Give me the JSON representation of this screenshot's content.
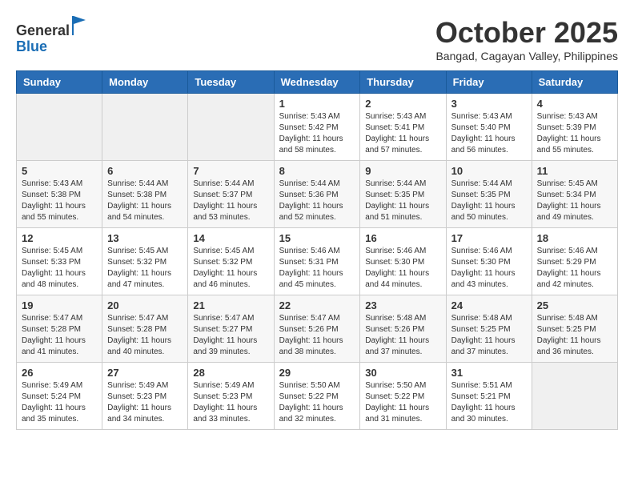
{
  "header": {
    "logo_line1": "General",
    "logo_line2": "Blue",
    "month": "October 2025",
    "location": "Bangad, Cagayan Valley, Philippines"
  },
  "weekdays": [
    "Sunday",
    "Monday",
    "Tuesday",
    "Wednesday",
    "Thursday",
    "Friday",
    "Saturday"
  ],
  "weeks": [
    [
      {
        "day": "",
        "info": ""
      },
      {
        "day": "",
        "info": ""
      },
      {
        "day": "",
        "info": ""
      },
      {
        "day": "1",
        "info": "Sunrise: 5:43 AM\nSunset: 5:42 PM\nDaylight: 11 hours\nand 58 minutes."
      },
      {
        "day": "2",
        "info": "Sunrise: 5:43 AM\nSunset: 5:41 PM\nDaylight: 11 hours\nand 57 minutes."
      },
      {
        "day": "3",
        "info": "Sunrise: 5:43 AM\nSunset: 5:40 PM\nDaylight: 11 hours\nand 56 minutes."
      },
      {
        "day": "4",
        "info": "Sunrise: 5:43 AM\nSunset: 5:39 PM\nDaylight: 11 hours\nand 55 minutes."
      }
    ],
    [
      {
        "day": "5",
        "info": "Sunrise: 5:43 AM\nSunset: 5:38 PM\nDaylight: 11 hours\nand 55 minutes."
      },
      {
        "day": "6",
        "info": "Sunrise: 5:44 AM\nSunset: 5:38 PM\nDaylight: 11 hours\nand 54 minutes."
      },
      {
        "day": "7",
        "info": "Sunrise: 5:44 AM\nSunset: 5:37 PM\nDaylight: 11 hours\nand 53 minutes."
      },
      {
        "day": "8",
        "info": "Sunrise: 5:44 AM\nSunset: 5:36 PM\nDaylight: 11 hours\nand 52 minutes."
      },
      {
        "day": "9",
        "info": "Sunrise: 5:44 AM\nSunset: 5:35 PM\nDaylight: 11 hours\nand 51 minutes."
      },
      {
        "day": "10",
        "info": "Sunrise: 5:44 AM\nSunset: 5:35 PM\nDaylight: 11 hours\nand 50 minutes."
      },
      {
        "day": "11",
        "info": "Sunrise: 5:45 AM\nSunset: 5:34 PM\nDaylight: 11 hours\nand 49 minutes."
      }
    ],
    [
      {
        "day": "12",
        "info": "Sunrise: 5:45 AM\nSunset: 5:33 PM\nDaylight: 11 hours\nand 48 minutes."
      },
      {
        "day": "13",
        "info": "Sunrise: 5:45 AM\nSunset: 5:32 PM\nDaylight: 11 hours\nand 47 minutes."
      },
      {
        "day": "14",
        "info": "Sunrise: 5:45 AM\nSunset: 5:32 PM\nDaylight: 11 hours\nand 46 minutes."
      },
      {
        "day": "15",
        "info": "Sunrise: 5:46 AM\nSunset: 5:31 PM\nDaylight: 11 hours\nand 45 minutes."
      },
      {
        "day": "16",
        "info": "Sunrise: 5:46 AM\nSunset: 5:30 PM\nDaylight: 11 hours\nand 44 minutes."
      },
      {
        "day": "17",
        "info": "Sunrise: 5:46 AM\nSunset: 5:30 PM\nDaylight: 11 hours\nand 43 minutes."
      },
      {
        "day": "18",
        "info": "Sunrise: 5:46 AM\nSunset: 5:29 PM\nDaylight: 11 hours\nand 42 minutes."
      }
    ],
    [
      {
        "day": "19",
        "info": "Sunrise: 5:47 AM\nSunset: 5:28 PM\nDaylight: 11 hours\nand 41 minutes."
      },
      {
        "day": "20",
        "info": "Sunrise: 5:47 AM\nSunset: 5:28 PM\nDaylight: 11 hours\nand 40 minutes."
      },
      {
        "day": "21",
        "info": "Sunrise: 5:47 AM\nSunset: 5:27 PM\nDaylight: 11 hours\nand 39 minutes."
      },
      {
        "day": "22",
        "info": "Sunrise: 5:47 AM\nSunset: 5:26 PM\nDaylight: 11 hours\nand 38 minutes."
      },
      {
        "day": "23",
        "info": "Sunrise: 5:48 AM\nSunset: 5:26 PM\nDaylight: 11 hours\nand 37 minutes."
      },
      {
        "day": "24",
        "info": "Sunrise: 5:48 AM\nSunset: 5:25 PM\nDaylight: 11 hours\nand 37 minutes."
      },
      {
        "day": "25",
        "info": "Sunrise: 5:48 AM\nSunset: 5:25 PM\nDaylight: 11 hours\nand 36 minutes."
      }
    ],
    [
      {
        "day": "26",
        "info": "Sunrise: 5:49 AM\nSunset: 5:24 PM\nDaylight: 11 hours\nand 35 minutes."
      },
      {
        "day": "27",
        "info": "Sunrise: 5:49 AM\nSunset: 5:23 PM\nDaylight: 11 hours\nand 34 minutes."
      },
      {
        "day": "28",
        "info": "Sunrise: 5:49 AM\nSunset: 5:23 PM\nDaylight: 11 hours\nand 33 minutes."
      },
      {
        "day": "29",
        "info": "Sunrise: 5:50 AM\nSunset: 5:22 PM\nDaylight: 11 hours\nand 32 minutes."
      },
      {
        "day": "30",
        "info": "Sunrise: 5:50 AM\nSunset: 5:22 PM\nDaylight: 11 hours\nand 31 minutes."
      },
      {
        "day": "31",
        "info": "Sunrise: 5:51 AM\nSunset: 5:21 PM\nDaylight: 11 hours\nand 30 minutes."
      },
      {
        "day": "",
        "info": ""
      }
    ]
  ]
}
